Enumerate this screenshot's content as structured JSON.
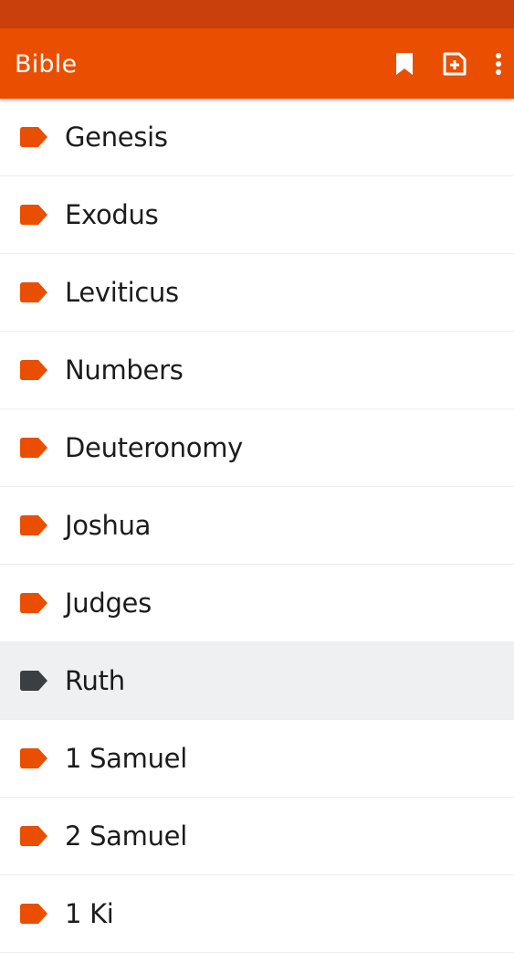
{
  "app_bar": {
    "title": "Bible",
    "color": "#ea4e00",
    "status_bar_color": "#c9400a",
    "actions": [
      {
        "icon": "bookmark-icon"
      },
      {
        "icon": "add-note-icon"
      },
      {
        "icon": "more-vert-icon"
      }
    ]
  },
  "books": {
    "accent": "#ea4e00",
    "selected_color": "#3b3f42",
    "items": [
      {
        "label": "Genesis",
        "selected": false
      },
      {
        "label": "Exodus",
        "selected": false
      },
      {
        "label": "Leviticus",
        "selected": false
      },
      {
        "label": "Numbers",
        "selected": false
      },
      {
        "label": "Deuteronomy",
        "selected": false
      },
      {
        "label": "Joshua",
        "selected": false
      },
      {
        "label": "Judges",
        "selected": false
      },
      {
        "label": "Ruth",
        "selected": true
      },
      {
        "label": "1 Samuel",
        "selected": false
      },
      {
        "label": "2 Samuel",
        "selected": false
      },
      {
        "label": "1 Ki",
        "selected": false
      }
    ]
  }
}
